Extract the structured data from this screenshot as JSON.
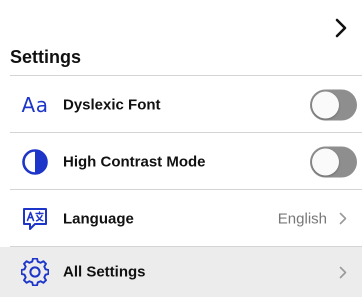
{
  "header": {
    "title": "Settings",
    "forward_icon": "chevron-right-icon"
  },
  "rows": [
    {
      "label": "Dyslexic Font",
      "icon": "text-size-icon",
      "icon_text": "Aa",
      "control": "toggle",
      "on": false
    },
    {
      "label": "High Contrast Mode",
      "icon": "contrast-icon",
      "control": "toggle",
      "on": false
    },
    {
      "label": "Language",
      "icon": "translate-icon",
      "control": "value",
      "value": "English",
      "chevron": "chevron-right-icon"
    },
    {
      "label": "All Settings",
      "icon": "gear-icon",
      "control": "link",
      "chevron": "chevron-right-icon",
      "highlighted": true
    }
  ],
  "colors": {
    "accent": "#1d35c9",
    "toggle_off": "#8e8e8e",
    "divider": "#d4d4d4",
    "highlight_row": "#ececec",
    "secondary_text": "#777777"
  }
}
